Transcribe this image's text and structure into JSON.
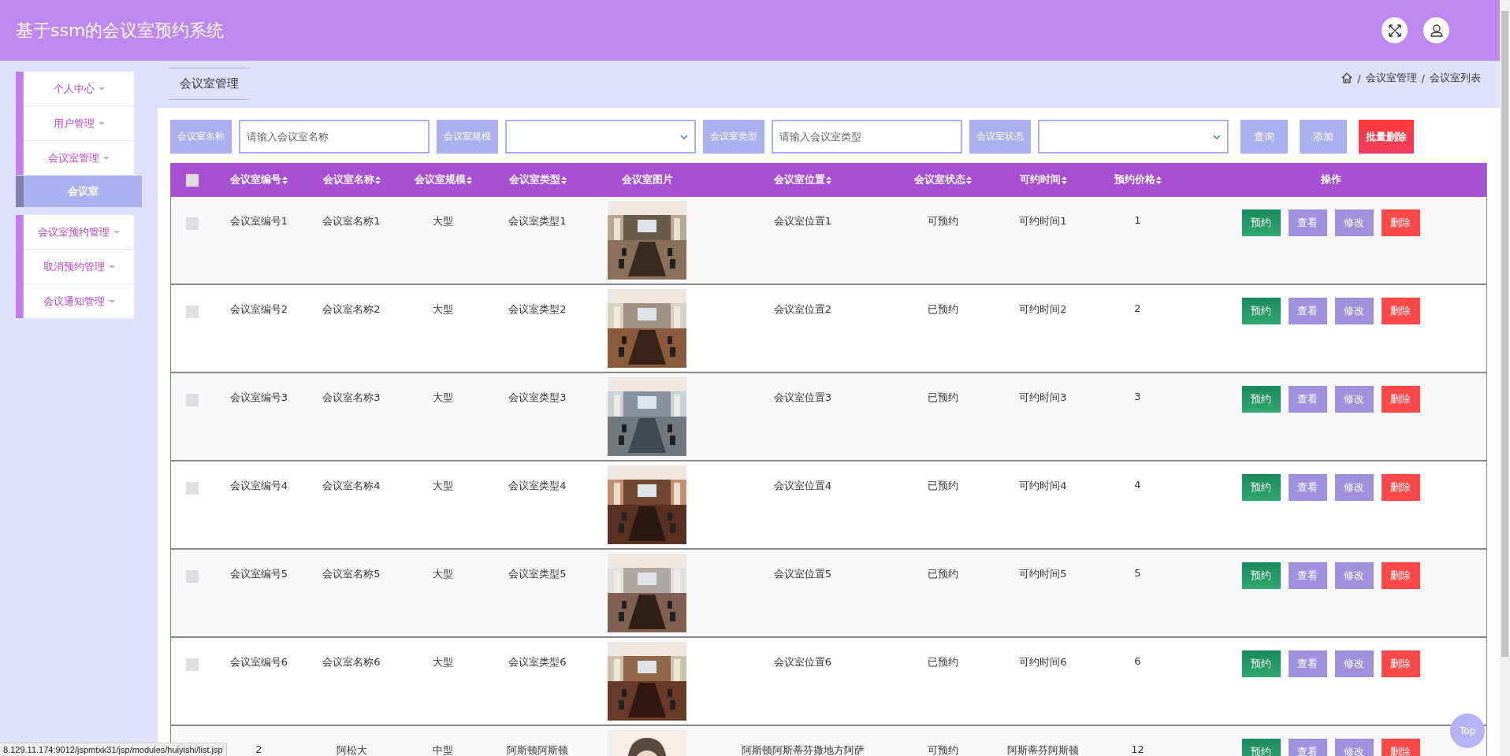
{
  "header": {
    "title": "基于ssm的会议室预约系统"
  },
  "sidebar": {
    "groups": [
      {
        "items": [
          {
            "label": "个人中心",
            "selected": false
          },
          {
            "label": "用户管理",
            "selected": false
          },
          {
            "label": "会议室管理",
            "selected": false,
            "children": [
              {
                "label": "会议室",
                "selected": true
              }
            ]
          }
        ]
      },
      {
        "items": [
          {
            "label": "会议室预约管理",
            "selected": false
          },
          {
            "label": "取消预约管理",
            "selected": false
          },
          {
            "label": "会议通知管理",
            "selected": false
          }
        ]
      }
    ]
  },
  "tab": {
    "label": "会议室管理"
  },
  "breadcrumb": {
    "separator": "/",
    "items": [
      "会议室管理",
      "会议室列表"
    ]
  },
  "filters": [
    {
      "label": "会议室名称",
      "kind": "text",
      "placeholder": "请输入会议室名称"
    },
    {
      "label": "会议室规模",
      "kind": "select"
    },
    {
      "label": "会议室类型",
      "kind": "text",
      "placeholder": "请输入会议室类型"
    },
    {
      "label": "会议室状态",
      "kind": "select"
    }
  ],
  "filter_buttons": [
    {
      "label": "查询",
      "kind": "primary"
    },
    {
      "label": "添加",
      "kind": "primary"
    },
    {
      "label": "批量删除",
      "kind": "danger"
    }
  ],
  "table": {
    "select_all": {
      "checked": false
    },
    "columns": [
      {
        "label": "会议室编号",
        "sortable": true
      },
      {
        "label": "会议室名称",
        "sortable": true
      },
      {
        "label": "会议室规模",
        "sortable": true
      },
      {
        "label": "会议室类型",
        "sortable": true
      },
      {
        "label": "会议室图片",
        "sortable": false
      },
      {
        "label": "会议室位置",
        "sortable": true
      },
      {
        "label": "会议室状态",
        "sortable": true
      },
      {
        "label": "可约时间",
        "sortable": true
      },
      {
        "label": "预约价格",
        "sortable": true
      },
      {
        "label": "操作",
        "sortable": false
      }
    ],
    "rows": [
      {
        "checked": false,
        "cells": [
          "会议室编号1",
          "会议室名称1",
          "大型",
          "会议室类型1",
          "",
          "会议室位置1",
          "可预约",
          "可约时间1",
          "1"
        ],
        "actions": [
          {
            "label": "预约",
            "kind": "book"
          },
          {
            "label": "查看",
            "kind": "view"
          },
          {
            "label": "修改",
            "kind": "edit"
          },
          {
            "label": "删除",
            "kind": "delete"
          }
        ]
      },
      {
        "checked": false,
        "cells": [
          "会议室编号2",
          "会议室名称2",
          "大型",
          "会议室类型2",
          "",
          "会议室位置2",
          "已预约",
          "可约时间2",
          "2"
        ],
        "actions": [
          {
            "label": "预约",
            "kind": "book"
          },
          {
            "label": "查看",
            "kind": "view"
          },
          {
            "label": "修改",
            "kind": "edit"
          },
          {
            "label": "删除",
            "kind": "delete"
          }
        ]
      },
      {
        "checked": false,
        "cells": [
          "会议室编号3",
          "会议室名称3",
          "大型",
          "会议室类型3",
          "",
          "会议室位置3",
          "已预约",
          "可约时间3",
          "3"
        ],
        "actions": [
          {
            "label": "预约",
            "kind": "book"
          },
          {
            "label": "查看",
            "kind": "view"
          },
          {
            "label": "修改",
            "kind": "edit"
          },
          {
            "label": "删除",
            "kind": "delete"
          }
        ]
      },
      {
        "checked": false,
        "cells": [
          "会议室编号4",
          "会议室名称4",
          "大型",
          "会议室类型4",
          "",
          "会议室位置4",
          "已预约",
          "可约时间4",
          "4"
        ],
        "actions": [
          {
            "label": "预约",
            "kind": "book"
          },
          {
            "label": "查看",
            "kind": "view"
          },
          {
            "label": "修改",
            "kind": "edit"
          },
          {
            "label": "删除",
            "kind": "delete"
          }
        ]
      },
      {
        "checked": false,
        "cells": [
          "会议室编号5",
          "会议室名称5",
          "大型",
          "会议室类型5",
          "",
          "会议室位置5",
          "已预约",
          "可约时间5",
          "5"
        ],
        "actions": [
          {
            "label": "预约",
            "kind": "book"
          },
          {
            "label": "查看",
            "kind": "view"
          },
          {
            "label": "修改",
            "kind": "edit"
          },
          {
            "label": "删除",
            "kind": "delete"
          }
        ]
      },
      {
        "checked": false,
        "cells": [
          "会议室编号6",
          "会议室名称6",
          "大型",
          "会议室类型6",
          "",
          "会议室位置6",
          "已预约",
          "可约时间6",
          "6"
        ],
        "actions": [
          {
            "label": "预约",
            "kind": "book"
          },
          {
            "label": "查看",
            "kind": "view"
          },
          {
            "label": "修改",
            "kind": "edit"
          },
          {
            "label": "删除",
            "kind": "delete"
          }
        ]
      },
      {
        "cells": [
          "2",
          "阿松大",
          "中型",
          "阿斯顿阿斯顿",
          "",
          "阿斯顿阿斯蒂芬撒地方阿萨",
          "可预约",
          "阿斯蒂芬阿斯顿",
          "12"
        ],
        "actions": [
          {
            "label": "预约",
            "kind": "book"
          },
          {
            "label": "查看",
            "kind": "view"
          },
          {
            "label": "修改",
            "kind": "edit"
          },
          {
            "label": "删除",
            "kind": "delete"
          }
        ]
      }
    ]
  },
  "status_url": "8.129.11.174:9012/jspmtxk31/jsp/modules/huiyishi/list.jsp",
  "top_button": {
    "label": "Top"
  }
}
